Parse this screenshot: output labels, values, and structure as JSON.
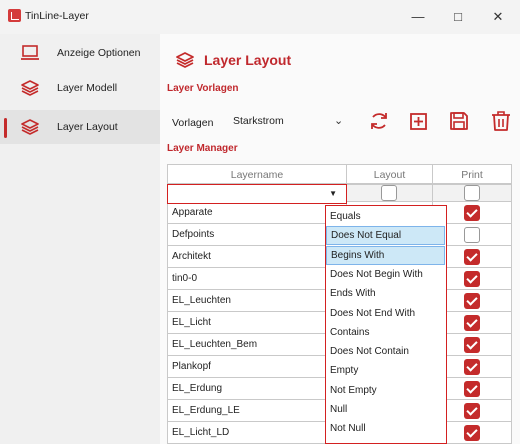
{
  "window": {
    "title": "TinLine-Layer",
    "minimize": "—",
    "maximize": "□",
    "close": "✕"
  },
  "sidebar": {
    "items": [
      {
        "label": "Anzeige Optionen",
        "icon": "monitor-icon"
      },
      {
        "label": "Layer Modell",
        "icon": "layers-icon"
      },
      {
        "label": "Layer Layout",
        "icon": "layers-icon",
        "active": true
      }
    ]
  },
  "main": {
    "title": "Layer Layout",
    "section_vorlagen": "Layer Vorlagen",
    "vorlagen_label": "Vorlagen",
    "vorlagen_value": "Starkstrom",
    "toolbar": [
      "refresh-icon",
      "add-icon",
      "save-icon",
      "delete-icon"
    ],
    "section_manager": "Layer Manager"
  },
  "grid": {
    "columns": [
      "Layername",
      "Layout",
      "Print"
    ],
    "rows": [
      {
        "name": "Apparate",
        "print": true
      },
      {
        "name": "Defpoints",
        "print": false
      },
      {
        "name": "Architekt",
        "print": true
      },
      {
        "name": "tin0-0",
        "print": true
      },
      {
        "name": "EL_Leuchten",
        "print": true
      },
      {
        "name": "EL_Licht",
        "print": true
      },
      {
        "name": "EL_Leuchten_Bem",
        "print": true
      },
      {
        "name": "Plankopf",
        "print": true
      },
      {
        "name": "EL_Erdung",
        "print": true
      },
      {
        "name": "EL_Erdung_LE",
        "print": true
      },
      {
        "name": "EL_Licht_LD",
        "layout": true,
        "print": true
      }
    ]
  },
  "filter_dropdown": {
    "options": [
      "Equals",
      "Does Not Equal",
      "Begins With",
      "Does Not Begin With",
      "Ends With",
      "Does Not End With",
      "Contains",
      "Does Not Contain",
      "Empty",
      "Not Empty",
      "Null",
      "Not Null"
    ],
    "highlighted": [
      "Does Not Equal",
      "Begins With"
    ]
  },
  "colors": {
    "accent": "#c0282d"
  }
}
